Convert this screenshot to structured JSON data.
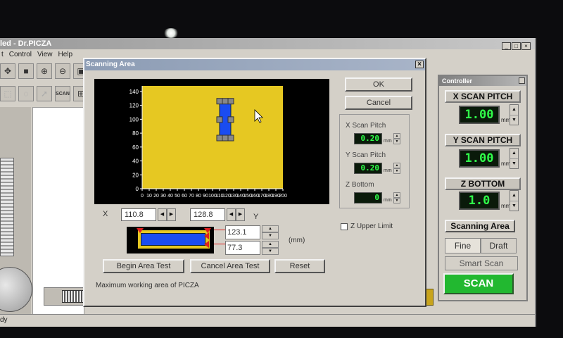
{
  "main_window": {
    "title": "led - Dr.PICZA",
    "menu": [
      "t",
      "Control",
      "View",
      "Help"
    ],
    "window_buttons": [
      "_",
      "□",
      "×"
    ],
    "status": "dy"
  },
  "toolbar": {
    "scan_label": "SCAN"
  },
  "dialog": {
    "title": "Scanning Area",
    "close_glyph": "×",
    "ok": "OK",
    "cancel": "Cancel",
    "x_label": "X",
    "x_value": "110.8",
    "y_label": "Y",
    "y_value": "128.8",
    "width_value": "123.1",
    "height_value": "77.3",
    "mm_label": "(mm)",
    "begin_test": "Begin Area Test",
    "cancel_test": "Cancel Area Test",
    "reset": "Reset",
    "status": "Maximum working area of PICZA",
    "x_scan_pitch_label": "X Scan Pitch",
    "x_scan_pitch_value": "0.20",
    "y_scan_pitch_label": "Y Scan Pitch",
    "y_scan_pitch_value": "0.20",
    "z_bottom_label": "Z Bottom",
    "z_bottom_value": "0",
    "unit": "mm",
    "z_upper_limit": "Z Upper Limit"
  },
  "chart_data": {
    "type": "area",
    "x_ticks": [
      "0",
      "10",
      "20",
      "30",
      "40",
      "50",
      "60",
      "70",
      "80",
      "90",
      "100",
      "110",
      "120",
      "130",
      "140",
      "150",
      "160",
      "170",
      "180",
      "190",
      "200"
    ],
    "y_ticks": [
      "0",
      "20",
      "40",
      "60",
      "80",
      "100",
      "120",
      "140"
    ],
    "xlim": [
      0,
      200
    ],
    "ylim": [
      0,
      148
    ],
    "work_area": {
      "x": [
        0,
        200
      ],
      "y": [
        0,
        148
      ]
    },
    "selection": {
      "x": [
        110,
        126
      ],
      "y": [
        73,
        126
      ]
    },
    "colors": {
      "work_area": "#e6c822",
      "selection": "#1a4cf0",
      "background": "#000000",
      "ticks": "#ffffff"
    }
  },
  "controller": {
    "title": "Controller",
    "x_scan_pitch_label": "X SCAN PITCH",
    "x_scan_pitch_value": "1.00",
    "y_scan_pitch_label": "Y SCAN PITCH",
    "y_scan_pitch_value": "1.00",
    "z_bottom_label": "Z BOTTOM",
    "z_bottom_value": "1.0",
    "unit": "mm",
    "scanning_area": "Scanning Area",
    "fine": "Fine",
    "draft": "Draft",
    "smart_scan": "Smart Scan",
    "scan": "SCAN"
  },
  "colors": {
    "lcd_text": "#30ff4a",
    "scan_button": "#22b830"
  }
}
